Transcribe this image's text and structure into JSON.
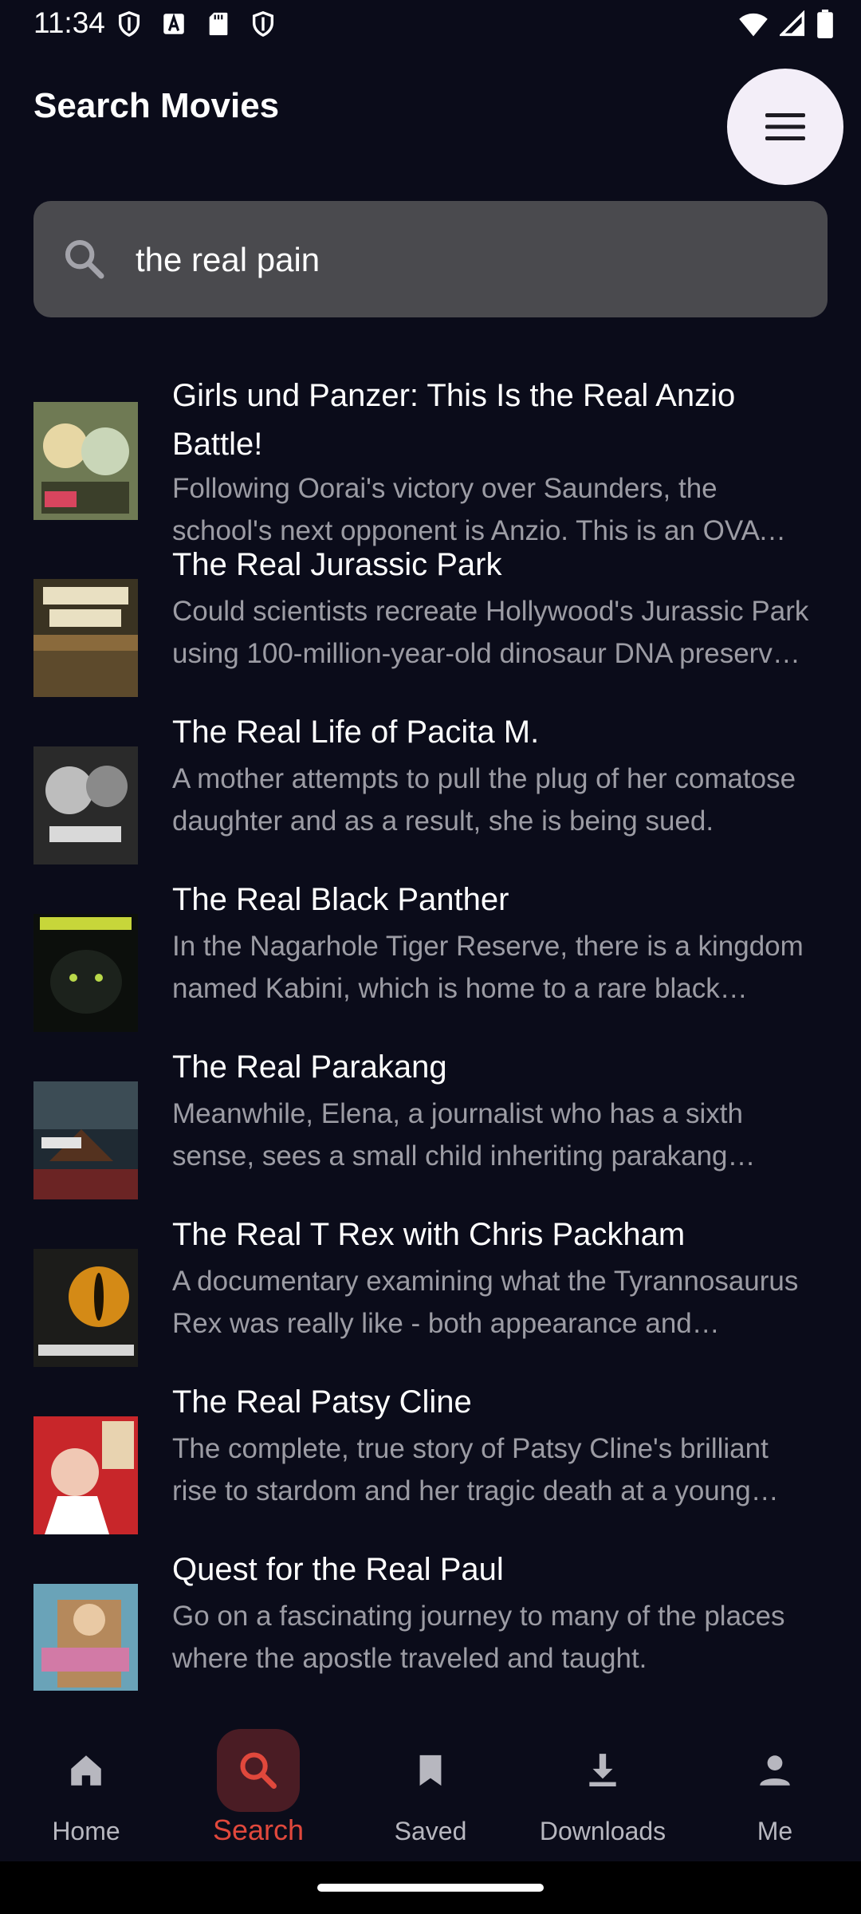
{
  "status_bar": {
    "time": "11:34",
    "left_icons": [
      "shield-icon",
      "text-a-icon",
      "sd-card-icon",
      "shield-icon"
    ],
    "right_icons": [
      "wifi-icon",
      "signal-icon",
      "battery-icon"
    ]
  },
  "header": {
    "title": "Search Movies",
    "menu_icon": "hamburger-menu-icon"
  },
  "search": {
    "value": "the real pain",
    "icon": "search-icon"
  },
  "results": [
    {
      "title": "Girls und Panzer: This Is the Real Anzio Battle!",
      "description": "Following Oorai's victory over Saunders, the school's next opponent is Anzio. This is an OVA that depicts the battle with Anzio."
    },
    {
      "title": "The Real Jurassic Park",
      "description": "Could scientists recreate Hollywood's Jurassic Park using 100-million-year-old dinosaur DNA preserved in amber?"
    },
    {
      "title": "The Real Life of Pacita M.",
      "description": "A mother attempts to pull the plug of her comatose daughter and as a result, she is being sued."
    },
    {
      "title": "The Real Black Panther",
      "description": "In the Nagarhole Tiger Reserve, there is a kingdom named Kabini, which is home to a rare black panther."
    },
    {
      "title": "The Real Parakang",
      "description": "Meanwhile, Elena, a journalist who has a sixth sense, sees a small child inheriting parakang powers."
    },
    {
      "title": "The Real T Rex with Chris Packham",
      "description": "A documentary examining what the Tyrannosaurus Rex was really like - both appearance and behaviour."
    },
    {
      "title": "The Real Patsy Cline",
      "description": "The complete, true story of Patsy Cline's brilliant rise to stardom and her tragic death at a young age."
    },
    {
      "title": "Quest for the Real Paul",
      "description": "Go on a fascinating journey to many of the places where the apostle traveled and taught."
    }
  ],
  "bottom_nav": [
    {
      "label": "Home",
      "icon": "home-icon",
      "active": false
    },
    {
      "label": "Search",
      "icon": "search-icon",
      "active": true
    },
    {
      "label": "Saved",
      "icon": "bookmark-icon",
      "active": false
    },
    {
      "label": "Downloads",
      "icon": "download-icon",
      "active": false
    },
    {
      "label": "Me",
      "icon": "person-icon",
      "active": false
    }
  ],
  "colors": {
    "background": "#0b0c1a",
    "accent": "#e0483c",
    "search_field": "#4a4a4e",
    "secondary_text": "#9c9ca4"
  }
}
